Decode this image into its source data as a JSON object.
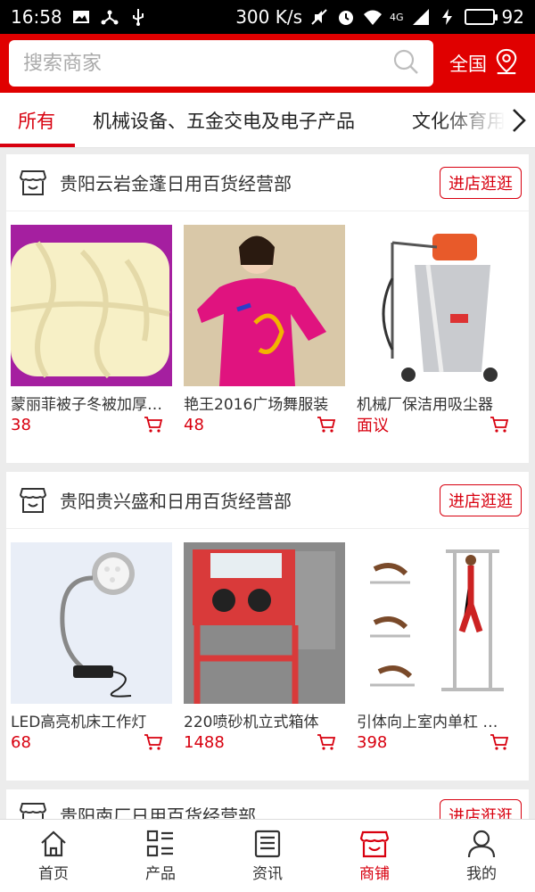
{
  "status_bar": {
    "time": "16:58",
    "speed": "300 K/s",
    "network": "4G",
    "battery": "92",
    "battery_level": 0.92
  },
  "search": {
    "placeholder": "搜索商家",
    "region_label": "全国"
  },
  "tabs": [
    {
      "label": "所有",
      "active": true
    },
    {
      "label": "机械设备、五金交电及电子产品",
      "active": false
    },
    {
      "label": "文化体育用品",
      "active": false
    }
  ],
  "colors": {
    "brand_red": "#e00000",
    "price_red": "#d8000f"
  },
  "shops": [
    {
      "name": "贵阳云岩金蓬日用百货经营部",
      "button": "进店逛逛",
      "products": [
        {
          "name": "蒙丽菲被子冬被加厚保暖",
          "price": "38",
          "image": "white-quilt"
        },
        {
          "name": "艳王2016广场舞服装",
          "price": "48",
          "image": "pink-dance-top"
        },
        {
          "name": "机械厂保洁用吸尘器",
          "price": "面议",
          "image": "industrial-vacuum"
        }
      ]
    },
    {
      "name": "贵阳贵兴盛和日用百货经营部",
      "button": "进店逛逛",
      "products": [
        {
          "name": "LED高亮机床工作灯",
          "price": "68",
          "image": "led-lamp"
        },
        {
          "name": "220喷砂机立式箱体",
          "price": "1488",
          "image": "sandblast-cabinet"
        },
        {
          "name": "引体向上室内单杠 健身",
          "price": "398",
          "image": "fitness-rack"
        }
      ]
    },
    {
      "name": "贵阳南厂日用百货经营部",
      "button": "进店逛逛",
      "products": []
    }
  ],
  "bottom_nav": [
    {
      "label": "首页",
      "icon": "home-icon",
      "active": false
    },
    {
      "label": "产品",
      "icon": "grid-list-icon",
      "active": false
    },
    {
      "label": "资讯",
      "icon": "news-icon",
      "active": false
    },
    {
      "label": "商铺",
      "icon": "shop-icon",
      "active": true
    },
    {
      "label": "我的",
      "icon": "user-icon",
      "active": false
    }
  ]
}
